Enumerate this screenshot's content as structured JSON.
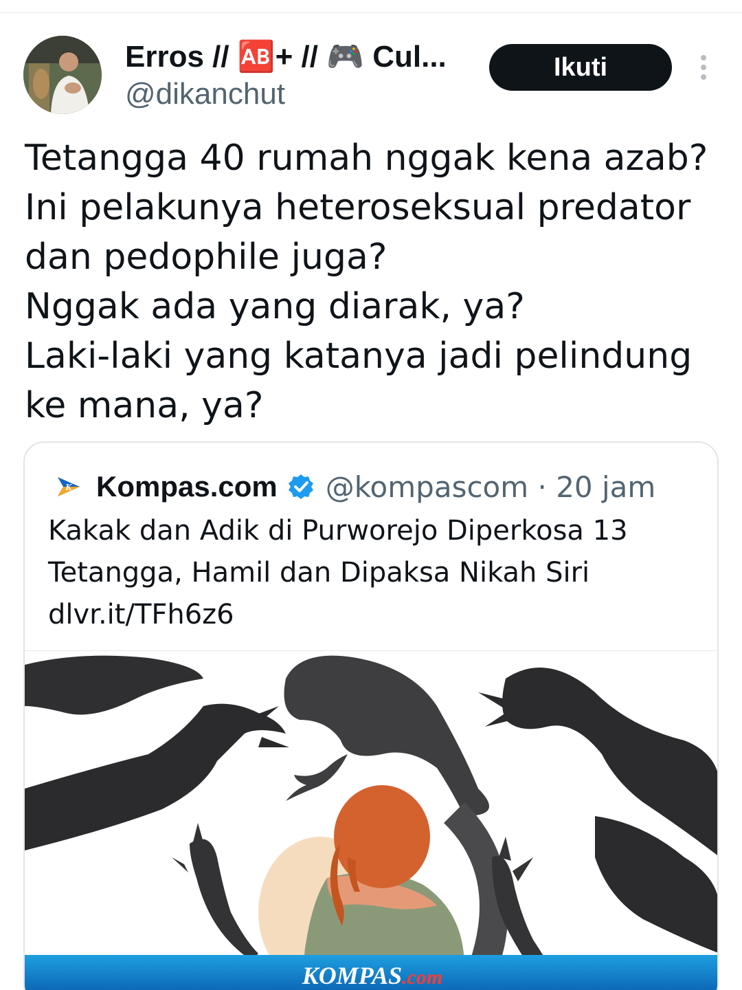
{
  "tweet": {
    "display_name": "Erros // 🆎+ // 🎮 Cul...",
    "handle": "@dikanchut",
    "follow_label": "Ikuti",
    "more_icon": "more-vertical-icon",
    "text_lines": [
      "Tetangga 40 rumah nggak kena azab?",
      "Ini pelakunya heteroseksual predator",
      "dan pedophile juga?",
      "Nggak ada yang diarak, ya?",
      "Laki-laki yang katanya jadi pelindung",
      "ke mana, ya?"
    ]
  },
  "quote": {
    "source_name": "Kompas.com",
    "verified_icon": "verified-badge-icon",
    "meta": "@kompascom · 20 jam",
    "text_lines": [
      "Kakak dan Adik di Purworejo Diperkosa 13",
      "Tetangga, Hamil dan Dipaksa Nikah Siri",
      "dlvr.it/TFh6z6"
    ],
    "image": {
      "brand": "KOMPAS",
      "brand_suffix": ".com"
    }
  },
  "colors": {
    "follow_bg": "#0f1419",
    "verified": "#1d9bf0",
    "banner": "#0b5fb0"
  }
}
